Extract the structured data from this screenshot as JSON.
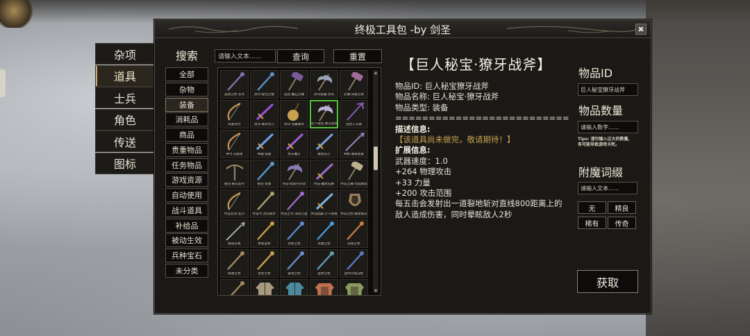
{
  "window": {
    "title": "终极工具包 -by 剑圣",
    "close_label": "✖"
  },
  "category_tabs": [
    {
      "label": "杂项",
      "active": false
    },
    {
      "label": "道具",
      "active": true
    },
    {
      "label": "士兵",
      "active": false
    },
    {
      "label": "角色",
      "active": false
    },
    {
      "label": "传送",
      "active": false
    },
    {
      "label": "图标",
      "active": false
    }
  ],
  "search": {
    "label": "搜索",
    "placeholder": "请输入文本......",
    "query_label": "查询",
    "reset_label": "重置"
  },
  "subcategories": [
    {
      "label": "全部",
      "active": false
    },
    {
      "label": "杂物",
      "active": false
    },
    {
      "label": "装备",
      "active": true
    },
    {
      "label": "消耗品",
      "active": false
    },
    {
      "label": "商品",
      "active": false
    },
    {
      "label": "贵重物品",
      "active": false
    },
    {
      "label": "任务物品",
      "active": false
    },
    {
      "label": "游戏资源",
      "active": false
    },
    {
      "label": "自动使用",
      "active": false
    },
    {
      "label": "战斗道具",
      "active": false
    },
    {
      "label": "补给品",
      "active": false
    },
    {
      "label": "被动生效",
      "active": false
    },
    {
      "label": "兵种宝石",
      "active": false
    },
    {
      "label": "未分类",
      "active": false
    }
  ],
  "items": [
    {
      "caption": "巫者之杖·苍穹",
      "icon": "staff-icon",
      "color": "#8a6fb3"
    },
    {
      "caption": "封印·极北之棍",
      "icon": "staff-icon",
      "color": "#5b8fc9"
    },
    {
      "caption": "远古·魔石之锤",
      "icon": "hammer-icon",
      "color": "#7a5a9a"
    },
    {
      "caption": "封印猎器·赤风",
      "icon": "axe-icon",
      "color": "#9aa1b8"
    },
    {
      "caption": "巨锤·风暴之雨",
      "icon": "hammer-icon",
      "color": "#a06a9a"
    },
    {
      "caption": "风暴羽弓",
      "icon": "bow-icon",
      "color": "#c08a4a"
    },
    {
      "caption": "封印·暴风弯刀",
      "icon": "sword-icon",
      "color": "#9b4fd0"
    },
    {
      "caption": "封印·羽翼盾琴",
      "icon": "lute-icon",
      "color": "#c9a050"
    },
    {
      "caption": "巨人秘宝·獠牙战斧",
      "icon": "axe-icon",
      "color": "#b9b0d8",
      "selected": true
    },
    {
      "caption": "远古三叉戟",
      "icon": "trident-icon",
      "color": "#8a5ab8"
    },
    {
      "caption": "神弓·天狼星",
      "icon": "bow-icon",
      "color": "#c28a50"
    },
    {
      "caption": "神器·雷霆",
      "icon": "sword-icon",
      "color": "#6aa0e0"
    },
    {
      "caption": "龙牙魔刃",
      "icon": "sword-icon",
      "color": "#a05ad0"
    },
    {
      "caption": "群星光刃",
      "icon": "sword-icon",
      "color": "#7a9ad8"
    },
    {
      "caption": "神枪·璀璨星辰",
      "icon": "spear-icon",
      "color": "#9a8ac8"
    },
    {
      "caption": "秘宝·繁花弦弓",
      "icon": "crossbow-icon",
      "color": "#b09060"
    },
    {
      "caption": "秘宝·龙啸",
      "icon": "staff-icon",
      "color": "#5a9ad0"
    },
    {
      "caption": "传说·暗影月牙斩",
      "icon": "axe-icon",
      "color": "#8a7ab0"
    },
    {
      "caption": "传说·魔龙狂舞",
      "icon": "sword-icon",
      "color": "#9a6ac0"
    },
    {
      "caption": "传说之锤·烈焰燃烧",
      "icon": "hammer-icon",
      "color": "#c0b090"
    },
    {
      "caption": "传说巨剑·狂沙",
      "icon": "bow-icon",
      "color": "#c29050"
    },
    {
      "caption": "传说弓·灵风疾步",
      "icon": "staff-icon",
      "color": "#b0a070"
    },
    {
      "caption": "传说之弓·流风万里",
      "icon": "staff-icon",
      "color": "#a06ad0"
    },
    {
      "caption": "传说猎器·万千夜雨",
      "icon": "sword-icon",
      "color": "#7ab0d8"
    },
    {
      "caption": "传说之杖·群星极光",
      "icon": "shield-icon",
      "color": "#9a8060"
    },
    {
      "caption": "赫连长枪",
      "icon": "spear-icon",
      "color": "#a0a8b0"
    },
    {
      "caption": "本帮圣杖",
      "icon": "staff-icon",
      "color": "#c8a040"
    },
    {
      "caption": "灵眸之杖",
      "icon": "staff-icon",
      "color": "#5a8ad8"
    },
    {
      "caption": "冰霜之杖",
      "icon": "staff-icon",
      "color": "#4a9ae0"
    },
    {
      "caption": "光辉之杖",
      "icon": "staff-icon",
      "color": "#c87a40"
    },
    {
      "caption": "刷毒之杖",
      "icon": "staff-icon",
      "color": "#a08a60"
    },
    {
      "caption": "古老之杖",
      "icon": "staff-icon",
      "color": "#c8a050"
    },
    {
      "caption": "雷电之杖",
      "icon": "staff-icon",
      "color": "#6a8ad0"
    },
    {
      "caption": "运悟之杖",
      "icon": "staff-icon",
      "color": "#5aa0b0"
    },
    {
      "caption": "直坪闪电法杖",
      "icon": "staff-icon",
      "color": "#5a7ac8"
    },
    {
      "caption": "",
      "icon": "staff-icon",
      "color": "#a08a60"
    },
    {
      "caption": "",
      "icon": "robe-icon",
      "color": "#a89a80"
    },
    {
      "caption": "",
      "icon": "robe-icon",
      "color": "#4a8aa0"
    },
    {
      "caption": "",
      "icon": "armor-icon",
      "color": "#c07050"
    },
    {
      "caption": "",
      "icon": "armor-icon",
      "color": "#8a9a60"
    }
  ],
  "detail": {
    "title": "【巨人秘宝·獠牙战斧】",
    "lines": [
      {
        "text": "物品ID: 巨人秘宝獠牙战斧",
        "style": ""
      },
      {
        "text": "物品名称: 巨人秘宝·獠牙战斧",
        "style": ""
      },
      {
        "text": "物品类型: 装备",
        "style": ""
      },
      {
        "text": "==========================",
        "style": ""
      },
      {
        "text": "描述信息:",
        "style": "head"
      },
      {
        "text": "【该道具尚未做完，敬请期待！】",
        "style": "gold"
      },
      {
        "text": "扩展信息:",
        "style": "head"
      },
      {
        "text": "武器速度：1.0",
        "style": ""
      },
      {
        "text": "+264 物理攻击",
        "style": ""
      },
      {
        "text": "+33 力量",
        "style": ""
      },
      {
        "text": "+200 攻击范围",
        "style": ""
      },
      {
        "text": "每五击会发射出一道裂地斩对直线800距离上的敌人造成伤害，同时晕眩敌人2秒",
        "style": "wrap"
      }
    ]
  },
  "right_panel": {
    "item_id_label": "物品ID",
    "item_id_value": "巨人秘宝獠牙战斧",
    "quantity_label": "物品数量",
    "quantity_placeholder": "请输入数字......",
    "tips_line1": "Tips: 请勿输入过大的数量,",
    "tips_line2": "有可能导致游戏卡死。",
    "enchant_label": "附魔词缀",
    "enchant_placeholder": "请输入文本......",
    "enchant_buttons": [
      "无",
      "精良",
      "稀有",
      "传奇"
    ],
    "get_label": "获取"
  },
  "colors": {
    "accent_selected": "#56c43b",
    "gold_text": "#c9a24c",
    "panel_bg": "#1a1916"
  }
}
